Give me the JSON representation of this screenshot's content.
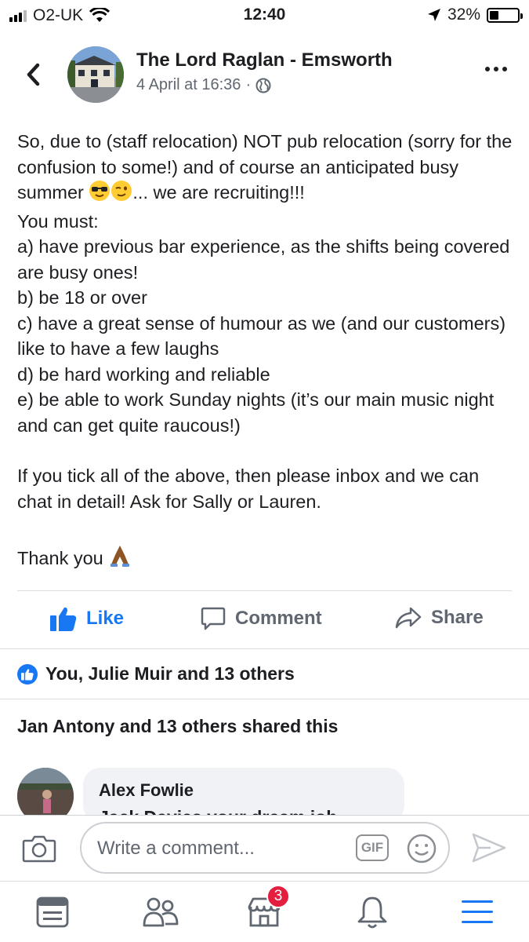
{
  "status_bar": {
    "carrier": "O2-UK",
    "time": "12:40",
    "battery": "32%",
    "battery_level": 0.32
  },
  "post": {
    "page_name": "The Lord Raglan - Emsworth",
    "timestamp": "4 April at 16:36",
    "privacy_separator": "·",
    "body_lines": [
      "So, due to (staff relocation) NOT pub relocation (sorry for the confusion to some!) and of course an anticipated busy summer",
      "... we are recruiting!!!",
      "You must:",
      "a) have previous bar experience, as the shifts being covered are busy ones!",
      "b) be 18 or over",
      "c) have a great sense of humour as we (and our customers) like to have a few laughs",
      "d) be hard working and reliable",
      "e) be able to work Sunday nights (it’s our main music night and can get quite raucous!)",
      "If you tick all of the above, then please inbox and we can chat in detail! Ask for Sally or Lauren.",
      "Thank you"
    ],
    "emojis": [
      "sunglasses-emoji",
      "wink-emoji",
      "praying-hands-emoji"
    ]
  },
  "actions": {
    "like": "Like",
    "comment": "Comment",
    "share": "Share"
  },
  "reactions_text": "You, Julie Muir and 13 others",
  "shares_text": "Jan Antony and 13 others shared this",
  "comment": {
    "author": "Alex Fowlie",
    "text": "Jack Davies your dream job"
  },
  "composer": {
    "placeholder": "Write a comment...",
    "gif_label": "GIF"
  },
  "tab_bar": {
    "marketplace_badge": "3"
  },
  "colors": {
    "accent": "#1877f2",
    "badge": "#e41e3f",
    "text": "#1c1e21",
    "muted": "#606770"
  }
}
